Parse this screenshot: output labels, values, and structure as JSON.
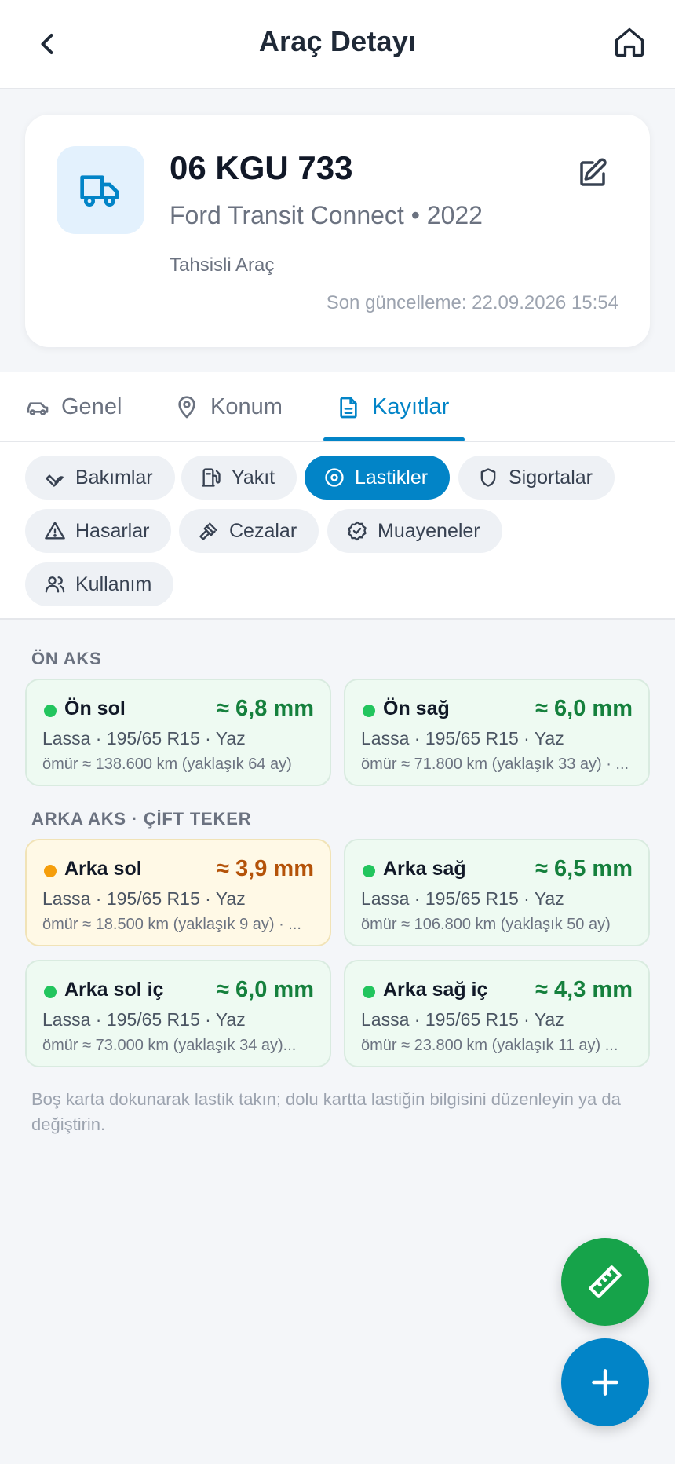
{
  "header": {
    "title": "Araç Detayı",
    "back_icon": "chevron-left-icon",
    "home_icon": "home-icon"
  },
  "vehicle": {
    "plate": "06 KGU 733",
    "model": "Ford Transit Connect • 2022",
    "type": "Tahsisli Araç",
    "updated": "Son güncelleme: 22.09.2026 15:54",
    "icon": "truck-icon",
    "edit_icon": "edit-icon"
  },
  "tabs": [
    {
      "label": "Genel",
      "icon": "car-icon",
      "active": false
    },
    {
      "label": "Konum",
      "icon": "map-pin-icon",
      "active": false
    },
    {
      "label": "Kayıtlar",
      "icon": "document-icon",
      "active": true
    }
  ],
  "chips": [
    {
      "label": "Bakımlar",
      "icon": "wrench-icon",
      "active": false
    },
    {
      "label": "Yakıt",
      "icon": "fuel-icon",
      "active": false
    },
    {
      "label": "Lastikler",
      "icon": "tire-icon",
      "active": true
    },
    {
      "label": "Sigortalar",
      "icon": "shield-icon",
      "active": false
    },
    {
      "label": "Hasarlar",
      "icon": "warning-icon",
      "active": false
    },
    {
      "label": "Cezalar",
      "icon": "gavel-icon",
      "active": false
    },
    {
      "label": "Muayeneler",
      "icon": "badge-check-icon",
      "active": false
    },
    {
      "label": "Kullanım",
      "icon": "users-icon",
      "active": false
    }
  ],
  "sections": [
    {
      "label": "ÖN AKS"
    },
    {
      "label": "ARKA AKS · ÇİFT TEKER"
    }
  ],
  "tires": [
    {
      "position": "Ön sol",
      "depth": "≈ 6,8 mm",
      "spec": "Lassa · 195/65 R15 · Yaz",
      "life": "ömür ≈ 138.600 km (yaklaşık 64 ay)",
      "status": "good",
      "status_color": "#22c55e"
    },
    {
      "position": "Ön sağ",
      "depth": "≈ 6,0 mm",
      "spec": "Lassa · 195/65 R15 · Yaz",
      "life": "ömür ≈ 71.800 km (yaklaşık 33 ay) · ...",
      "status": "good",
      "status_color": "#22c55e"
    },
    {
      "position": "Arka sol",
      "depth": "≈ 3,9 mm",
      "spec": "Lassa · 195/65 R15 · Yaz",
      "life": "ömür ≈ 18.500 km (yaklaşık 9 ay) · ...",
      "status": "warning",
      "status_color": "#f59e0b"
    },
    {
      "position": "Arka sağ",
      "depth": "≈ 6,5 mm",
      "spec": "Lassa · 195/65 R15 · Yaz",
      "life": "ömür ≈ 106.800 km (yaklaşık 50 ay)",
      "status": "good",
      "status_color": "#22c55e"
    },
    {
      "position": "Arka sol iç",
      "depth": "≈ 6,0 mm",
      "spec": "Lassa · 195/65 R15 · Yaz",
      "life": "ömür ≈ 73.000 km (yaklaşık 34 ay)...",
      "status": "good",
      "status_color": "#22c55e"
    },
    {
      "position": "Arka sağ iç",
      "depth": "≈ 4,3 mm",
      "spec": "Lassa · 195/65 R15 · Yaz",
      "life": "ömür ≈ 23.800 km (yaklaşık 11 ay) ...",
      "status": "good",
      "status_color": "#22c55e"
    }
  ],
  "hint": "Boş karta dokunarak lastik takın; dolu kartta lastiğin bilgisini düzenleyin ya da değiştirin.",
  "fabs": [
    {
      "icon": "ruler-icon",
      "color": "#16a34a"
    },
    {
      "icon": "plus-icon",
      "color": "#0284c7"
    }
  ],
  "colors": {
    "accent": "#0284c7",
    "good": "#15803d",
    "warning": "#b45309"
  }
}
